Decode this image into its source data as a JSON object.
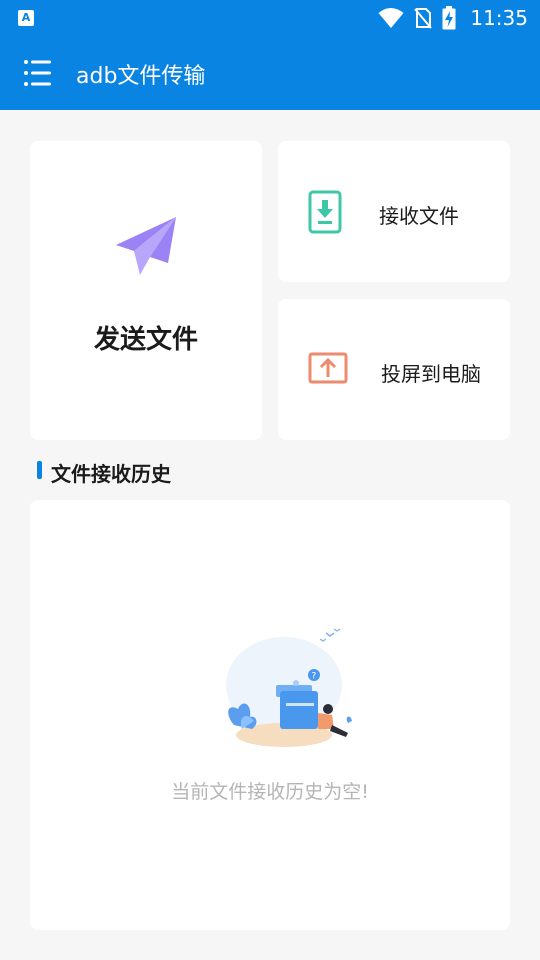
{
  "status_bar": {
    "app_badge": "A",
    "time": "11:35",
    "icons": [
      "wifi-icon",
      "no-sim-icon",
      "battery-charging-icon"
    ]
  },
  "app_bar": {
    "menu_icon": "menu-icon",
    "title": "adb文件传输"
  },
  "actions": {
    "send": {
      "label": "发送文件",
      "icon": "paper-plane-icon"
    },
    "receive": {
      "label": "接收文件",
      "icon": "download-file-icon"
    },
    "cast": {
      "label": "投屏到电脑",
      "icon": "upload-screen-icon"
    }
  },
  "history": {
    "title": "文件接收历史",
    "empty_text": "当前文件接收历史为空!"
  },
  "colors": {
    "primary": "#0a84e2",
    "send_icon": "#9b83f5",
    "receive_icon": "#3dc7a7",
    "cast_icon": "#ee8a6e",
    "background": "#f6f6f6"
  }
}
